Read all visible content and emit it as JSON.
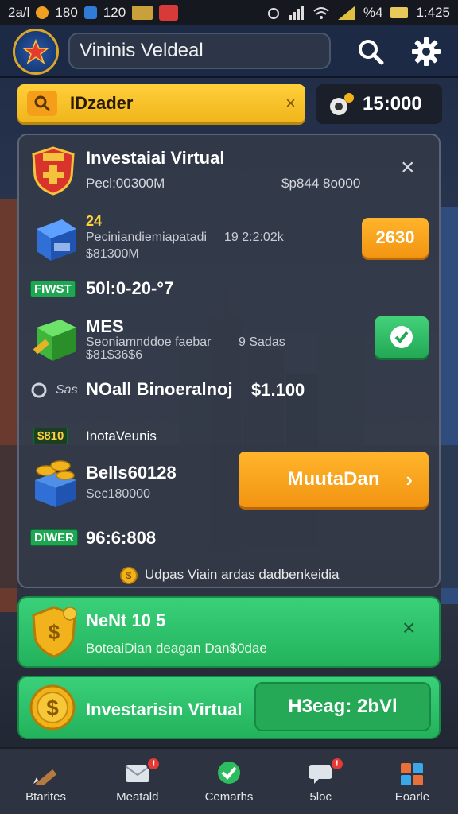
{
  "status_bar": {
    "left": [
      "2a/l",
      "180",
      "120"
    ],
    "right_percent": "%4",
    "time": "1:425"
  },
  "header": {
    "search_text": "Vininis Veldeal"
  },
  "promo": {
    "label": "IDzader",
    "close": "×",
    "coins": "15:000"
  },
  "panel": {
    "title": "Investaiai Virtual",
    "subtitle": "Pecl:00300M",
    "right_value": "$p844 8o000",
    "close": "×",
    "item1": {
      "badge_num": "24",
      "line1": "Peciniandiemiapatadi",
      "line1_value": "19 2:2:02k",
      "line2": "$81300M",
      "button": "2630"
    },
    "stat1": {
      "tag": "FIWST",
      "value": "50l:0-20-°7"
    },
    "item2": {
      "title": "MES",
      "line1": "Seoniamnddoe faebar",
      "line1_value": "9 Sadas",
      "line2": "$81$36$6"
    },
    "stat2": {
      "prefix": "Sas",
      "title": "NOall Binoeralnoj",
      "value": "$1.100"
    },
    "stat3": {
      "tag": "$810",
      "label": "InotaVeunis"
    },
    "item3": {
      "title": "Bells60128",
      "sub": "Sec180000",
      "button": "MuutaDan",
      "chevron": "›"
    },
    "stat4": {
      "tag": "DIWER",
      "value": "96:6:808"
    },
    "footer": "Udpas Viain ardas dadbenkeidia"
  },
  "notice1": {
    "title": "NeNt 10 5",
    "sub": "BoteaiDian deagan Dan$0dae",
    "close": "×"
  },
  "notice2": {
    "title": "Investarisin Virtual",
    "button": "H3eag: 2bVl"
  },
  "nav": [
    {
      "label": "Btarites",
      "icon": "pencil-icon"
    },
    {
      "label": "Meatald",
      "icon": "mail-icon"
    },
    {
      "label": "Cemarhs",
      "icon": "check-icon"
    },
    {
      "label": "5loc",
      "icon": "chat-icon"
    },
    {
      "label": "Eoarle",
      "icon": "puzzle-icon"
    }
  ]
}
